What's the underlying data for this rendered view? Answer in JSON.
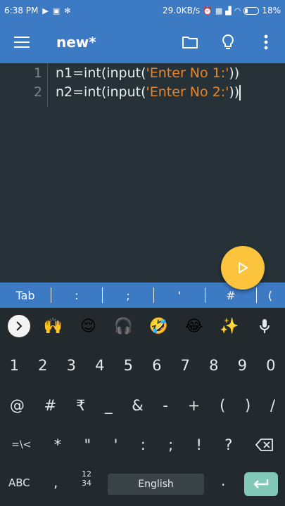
{
  "status_bar": {
    "time": "6:38 PM",
    "network_speed": "29.0KB/s",
    "battery_percent": "18%"
  },
  "app_bar": {
    "title": "new*"
  },
  "editor": {
    "lines": [
      {
        "number": "1",
        "code_prefix": "n1=int(input(",
        "string": "'Enter No 1:'",
        "code_suffix": "))"
      },
      {
        "number": "2",
        "code_prefix": "n2=int(input(",
        "string": "'Enter No 2:'",
        "code_suffix": "))"
      }
    ]
  },
  "symbol_bar": {
    "keys": [
      "Tab",
      ":",
      ";",
      "'",
      "#",
      "("
    ]
  },
  "keyboard": {
    "emoji_row": [
      "🙌",
      "😌",
      "🎧",
      "🤣",
      "😂",
      "✨"
    ],
    "number_row": [
      "1",
      "2",
      "3",
      "4",
      "5",
      "6",
      "7",
      "8",
      "9",
      "0"
    ],
    "symbol_row_1": [
      "@",
      "#",
      "₹",
      "_",
      "&",
      "-",
      "+",
      "(",
      ")",
      "/"
    ],
    "symbol_row_2": [
      "=\\<",
      "*",
      "\"",
      "'",
      ":",
      ";",
      "!",
      "?"
    ],
    "abc_label": "ABC",
    "comma_label": ",",
    "numpad_label_top": "12",
    "numpad_label_bottom": "34",
    "space_label": "English",
    "period_label": "."
  },
  "colors": {
    "primary": "#3d7ac4",
    "editor_bg": "#263238",
    "string": "#e8852c",
    "fab": "#fbc43c",
    "enter": "#81c8b6"
  }
}
